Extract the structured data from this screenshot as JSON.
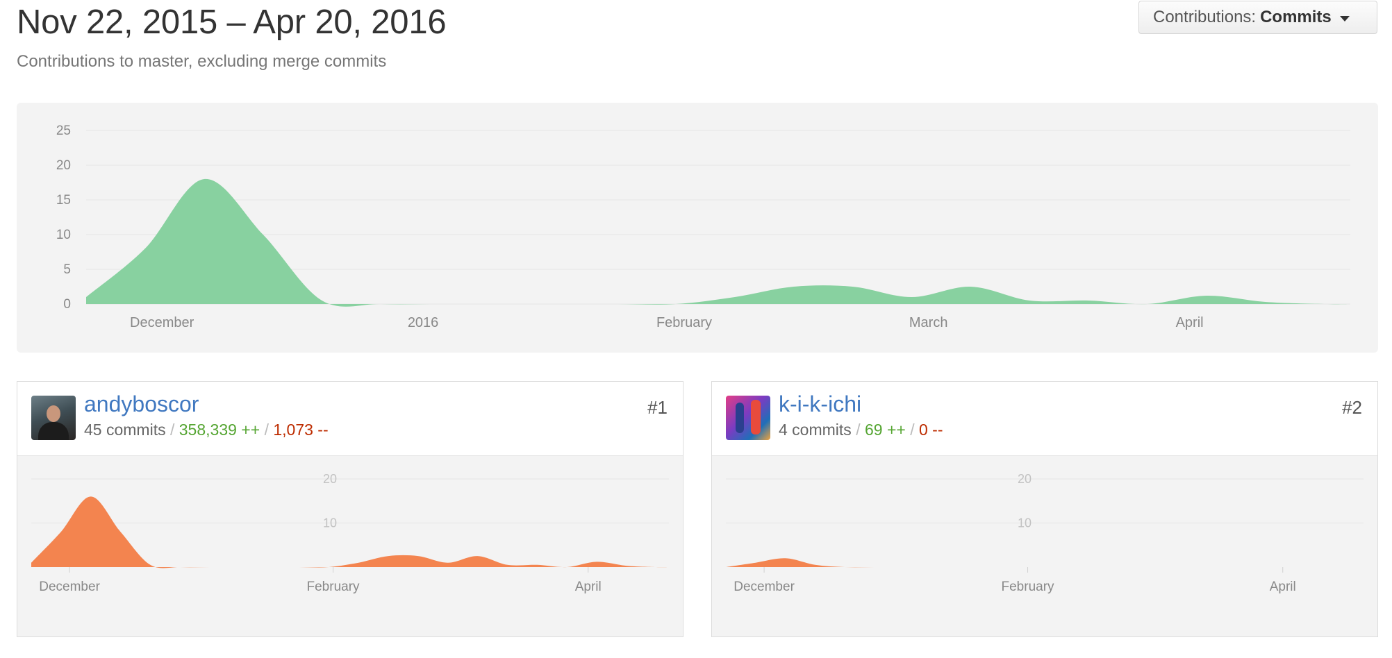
{
  "header": {
    "title": "Nov 22, 2015 – Apr 20, 2016",
    "subtitle": "Contributions to master, excluding merge commits"
  },
  "dropdown": {
    "prefix": "Contributions:",
    "value": "Commits",
    "icon": "caret-down-icon"
  },
  "colors": {
    "main_area": "#88d1a0",
    "contributor_area": "#f3844f",
    "link": "#4078c0",
    "additions": "#55a532",
    "deletions": "#bd2c00"
  },
  "chart_data": [
    {
      "type": "area",
      "x_range": [
        "2015-11-22",
        "2016-04-20"
      ],
      "ylim": [
        0,
        25
      ],
      "y_ticks": [
        0,
        5,
        10,
        15,
        20,
        25
      ],
      "x_ticks": [
        {
          "date": "2015-12-01",
          "label": "December"
        },
        {
          "date": "2016-01-01",
          "label": "2016"
        },
        {
          "date": "2016-02-01",
          "label": "February"
        },
        {
          "date": "2016-03-01",
          "label": "March"
        },
        {
          "date": "2016-04-01",
          "label": "April"
        }
      ],
      "x": [
        "2015-11-22",
        "2015-11-29",
        "2015-12-06",
        "2015-12-13",
        "2015-12-20",
        "2015-12-27",
        "2016-01-03",
        "2016-01-10",
        "2016-01-17",
        "2016-01-24",
        "2016-01-31",
        "2016-02-07",
        "2016-02-14",
        "2016-02-21",
        "2016-02-28",
        "2016-03-06",
        "2016-03-13",
        "2016-03-20",
        "2016-03-27",
        "2016-04-03",
        "2016-04-10",
        "2016-04-17"
      ],
      "values": [
        1,
        8,
        18,
        10,
        0.5,
        0,
        0,
        0,
        0,
        0,
        0,
        1,
        2.5,
        2.5,
        1,
        2.5,
        0.5,
        0.5,
        0,
        1.2,
        0.3,
        0
      ],
      "grid": true
    },
    {
      "type": "area",
      "x_range": [
        "2015-11-22",
        "2016-04-20"
      ],
      "ylim": [
        0,
        20
      ],
      "y_ticks": [
        10,
        20
      ],
      "x_ticks": [
        {
          "date": "2015-12-01",
          "label": "December"
        },
        {
          "date": "2016-02-01",
          "label": "February"
        },
        {
          "date": "2016-04-01",
          "label": "April"
        }
      ],
      "x": [
        "2015-11-22",
        "2015-11-29",
        "2015-12-06",
        "2015-12-13",
        "2015-12-20",
        "2015-12-27",
        "2016-01-03",
        "2016-01-10",
        "2016-01-17",
        "2016-01-24",
        "2016-01-31",
        "2016-02-07",
        "2016-02-14",
        "2016-02-21",
        "2016-02-28",
        "2016-03-06",
        "2016-03-13",
        "2016-03-20",
        "2016-03-27",
        "2016-04-03",
        "2016-04-10",
        "2016-04-17"
      ],
      "values": [
        1,
        8,
        16,
        8,
        0.5,
        0,
        0,
        0,
        0,
        0,
        0,
        1,
        2.5,
        2.5,
        1,
        2.5,
        0.5,
        0.5,
        0,
        1.2,
        0.3,
        0
      ],
      "grid": true
    },
    {
      "type": "area",
      "x_range": [
        "2015-11-22",
        "2016-04-20"
      ],
      "ylim": [
        0,
        20
      ],
      "y_ticks": [
        10,
        20
      ],
      "x_ticks": [
        {
          "date": "2015-12-01",
          "label": "December"
        },
        {
          "date": "2016-02-01",
          "label": "February"
        },
        {
          "date": "2016-04-01",
          "label": "April"
        }
      ],
      "x": [
        "2015-11-22",
        "2015-11-29",
        "2015-12-06",
        "2015-12-13",
        "2015-12-20",
        "2015-12-27",
        "2016-01-03",
        "2016-01-10",
        "2016-01-17",
        "2016-01-24",
        "2016-01-31",
        "2016-02-07",
        "2016-02-14",
        "2016-02-21",
        "2016-02-28",
        "2016-03-06",
        "2016-03-13",
        "2016-03-20",
        "2016-03-27",
        "2016-04-03",
        "2016-04-10",
        "2016-04-17"
      ],
      "values": [
        0,
        1,
        2,
        0.5,
        0,
        0,
        0,
        0,
        0,
        0,
        0,
        0,
        0,
        0,
        0,
        0,
        0,
        0,
        0,
        0,
        0,
        0
      ],
      "grid": true
    }
  ],
  "contributors": [
    {
      "rank": "#1",
      "username": "andyboscor",
      "commits": "45 commits",
      "additions": "358,339 ++",
      "deletions": "1,073 --",
      "sep": "/"
    },
    {
      "rank": "#2",
      "username": "k-i-k-ichi",
      "commits": "4 commits",
      "additions": "69 ++",
      "deletions": "0 --",
      "sep": "/"
    }
  ]
}
